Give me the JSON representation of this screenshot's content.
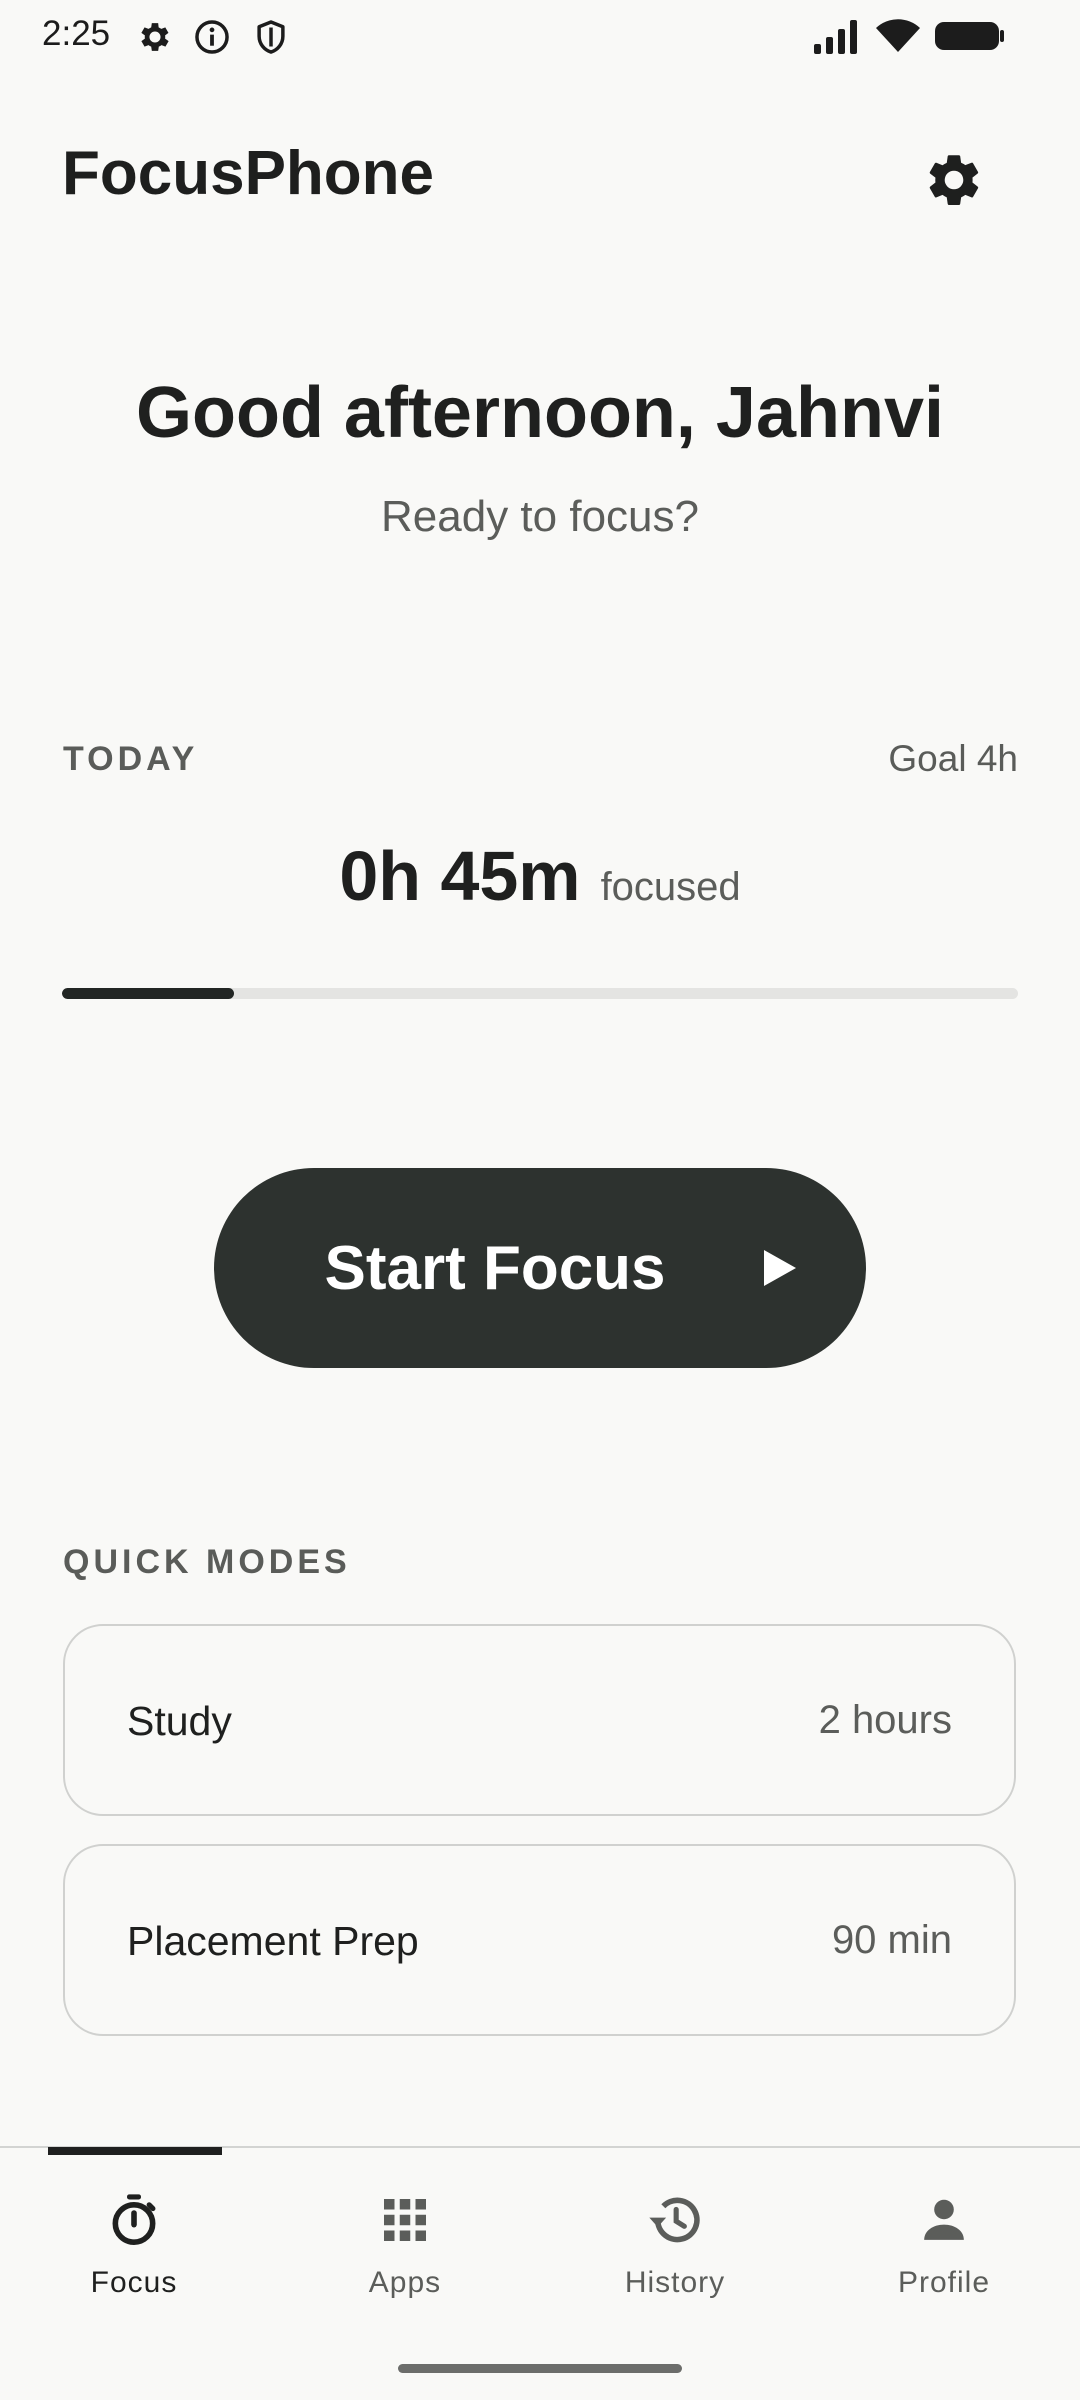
{
  "status_bar": {
    "time": "2:25"
  },
  "header": {
    "app_title": "FocusPhone"
  },
  "greeting": {
    "title": "Good afternoon, Jahnvi",
    "subtitle": "Ready to focus?"
  },
  "today": {
    "label": "TODAY",
    "goal": "Goal 4h",
    "focused_value": "0h 45m",
    "focused_suffix": "focused",
    "progress_fraction": 0.18
  },
  "start_button": {
    "label": "Start Focus"
  },
  "quick_modes": {
    "label": "QUICK MODES",
    "items": [
      {
        "name": "Study",
        "duration": "2 hours"
      },
      {
        "name": "Placement Prep",
        "duration": "90 min"
      }
    ]
  },
  "bottom_nav": {
    "items": [
      {
        "label": "Focus",
        "icon": "timer-icon",
        "active": true
      },
      {
        "label": "Apps",
        "icon": "apps-grid-icon",
        "active": false
      },
      {
        "label": "History",
        "icon": "history-icon",
        "active": false
      },
      {
        "label": "Profile",
        "icon": "person-icon",
        "active": false
      }
    ]
  },
  "colors": {
    "background": "#f9f9f7",
    "primary_dark": "#2d322f",
    "text_primary": "#1f201f",
    "text_secondary": "#5b5d5a"
  }
}
